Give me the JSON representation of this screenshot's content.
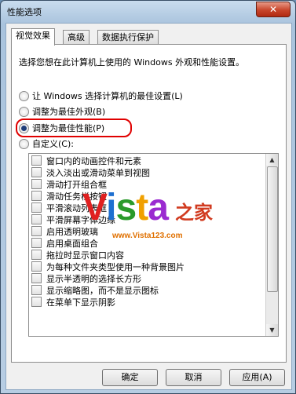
{
  "window": {
    "title": "性能选项",
    "close_glyph": "✕"
  },
  "tabs": [
    {
      "label": "视觉效果",
      "active": true
    },
    {
      "label": "高级",
      "active": false
    },
    {
      "label": "数据执行保护",
      "active": false
    }
  ],
  "description": "选择您想在此计算机上使用的 Windows 外观和性能设置。",
  "radios": [
    {
      "label": "让 Windows 选择计算机的最佳设置(L)",
      "selected": false
    },
    {
      "label": "调整为最佳外观(B)",
      "selected": false
    },
    {
      "label": "调整为最佳性能(P)",
      "selected": true
    },
    {
      "label": "自定义(C):",
      "selected": false
    }
  ],
  "effects": [
    "窗口内的动画控件和元素",
    "淡入淡出或滑动菜单到视图",
    "滑动打开组合框",
    "滑动任务栏按钮",
    "平滑滚动列表框",
    "平滑屏幕字体边缘",
    "启用透明玻璃",
    "启用桌面组合",
    "拖拉时显示窗口内容",
    "为每种文件夹类型使用一种背景图片",
    "显示半透明的选择长方形",
    "显示缩略图，而不是显示图标",
    "在菜单下显示阴影"
  ],
  "watermark": {
    "brand": "Vista",
    "brand_colors": [
      "#e02020",
      "#1e6fd0",
      "#2a9a2a",
      "#f0a000",
      "#9a2ad0"
    ],
    "suffix": "之家",
    "url": "www.Vista123.com"
  },
  "buttons": {
    "ok": "确定",
    "cancel": "取消",
    "apply": "应用(A)"
  },
  "colors": {
    "highlight": "#e00000",
    "selected_dot": "#1e3d7a"
  }
}
